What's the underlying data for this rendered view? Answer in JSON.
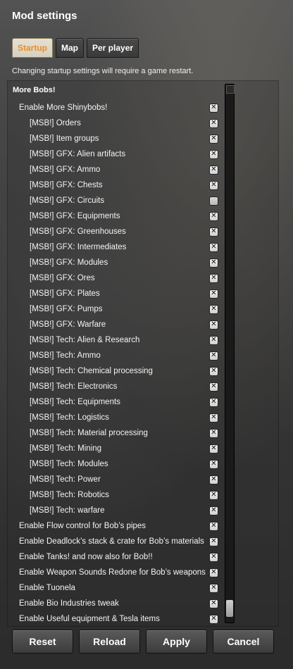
{
  "window": {
    "title": "Mod settings"
  },
  "tabs": [
    {
      "label": "Startup",
      "active": true
    },
    {
      "label": "Map",
      "active": false
    },
    {
      "label": "Per player",
      "active": false
    }
  ],
  "notice": "Changing startup settings will require a game restart.",
  "section": {
    "title": "More Bobs!"
  },
  "settings": [
    {
      "label": "Enable More Shinybobs!",
      "checked": true
    },
    {
      "label": "[MSB!] Orders",
      "checked": true
    },
    {
      "label": "[MSB!] Item groups",
      "checked": true
    },
    {
      "label": "[MSB!] GFX: Alien artifacts",
      "checked": true
    },
    {
      "label": "[MSB!] GFX: Ammo",
      "checked": true
    },
    {
      "label": "[MSB!] GFX: Chests",
      "checked": true
    },
    {
      "label": "[MSB!] GFX: Circuits",
      "checked": false
    },
    {
      "label": "[MSB!] GFX: Equipments",
      "checked": true
    },
    {
      "label": "[MSB!] GFX: Greenhouses",
      "checked": true
    },
    {
      "label": "[MSB!] GFX: Intermediates",
      "checked": true
    },
    {
      "label": "[MSB!] GFX: Modules",
      "checked": true
    },
    {
      "label": "[MSB!] GFX: Ores",
      "checked": true
    },
    {
      "label": "[MSB!] GFX: Plates",
      "checked": true
    },
    {
      "label": "[MSB!] GFX: Pumps",
      "checked": true
    },
    {
      "label": "[MSB!] GFX: Warfare",
      "checked": true
    },
    {
      "label": "[MSB!] Tech: Alien & Research",
      "checked": true
    },
    {
      "label": "[MSB!] Tech: Ammo",
      "checked": true
    },
    {
      "label": "[MSB!] Tech: Chemical processing",
      "checked": true
    },
    {
      "label": "[MSB!] Tech: Electronics",
      "checked": true
    },
    {
      "label": "[MSB!] Tech: Equipments",
      "checked": true
    },
    {
      "label": "[MSB!] Tech: Logistics",
      "checked": true
    },
    {
      "label": "[MSB!] Tech: Material processing",
      "checked": true
    },
    {
      "label": "[MSB!] Tech: Mining",
      "checked": true
    },
    {
      "label": "[MSB!] Tech: Modules",
      "checked": true
    },
    {
      "label": "[MSB!] Tech: Power",
      "checked": true
    },
    {
      "label": "[MSB!] Tech: Robotics",
      "checked": true
    },
    {
      "label": "[MSB!] Tech: warfare",
      "checked": true
    },
    {
      "label": "Enable Flow control for Bob’s pipes",
      "checked": true
    },
    {
      "label": "Enable Deadlock’s stack & crate for Bob’s materials",
      "checked": true
    },
    {
      "label": "Enable Tanks! and now also for Bob!!",
      "checked": true
    },
    {
      "label": "Enable Weapon Sounds Redone for Bob’s weapons",
      "checked": true
    },
    {
      "label": "Enable Tuonela",
      "checked": true
    },
    {
      "label": "Enable Bio Industries tweak",
      "checked": true
    },
    {
      "label": "Enable Useful equipment & Tesla items",
      "checked": true
    }
  ],
  "buttons": {
    "reset": "Reset",
    "reload": "Reload",
    "apply": "Apply",
    "cancel": "Cancel"
  }
}
